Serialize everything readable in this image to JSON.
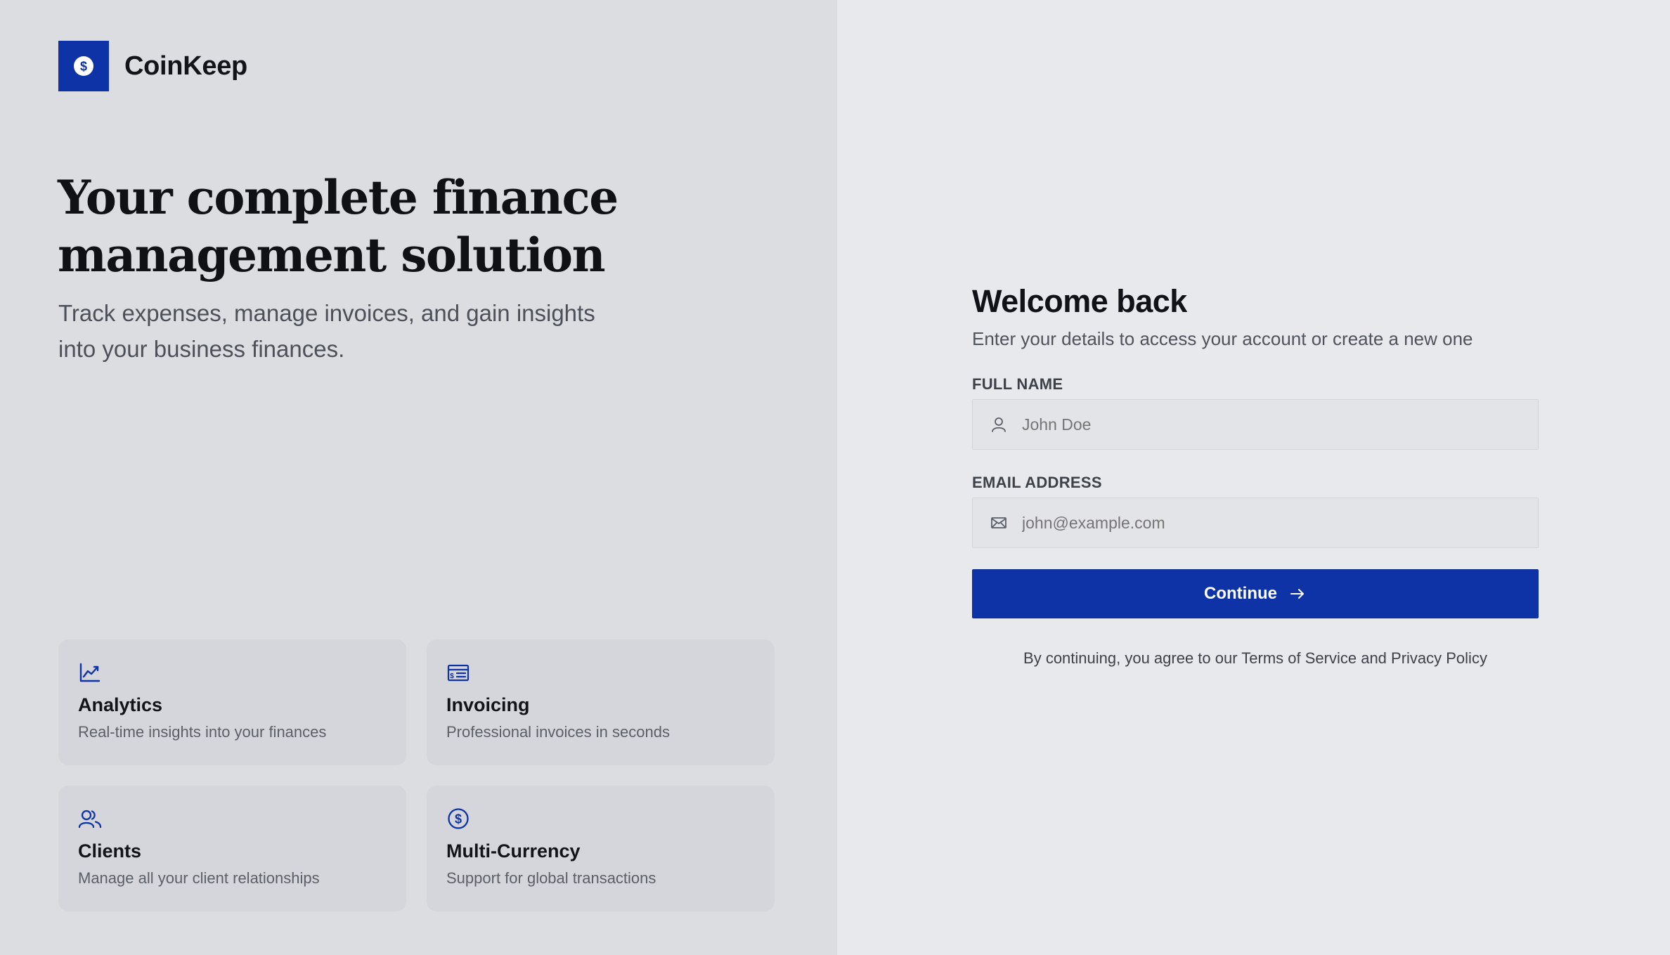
{
  "brand": {
    "name": "CoinKeep",
    "logo_icon": "dollar-circle-icon",
    "color": "#0e33a6"
  },
  "hero": {
    "title": "Your complete finance management solution",
    "subtitle": "Track expenses, manage invoices, and gain insights into your business finances."
  },
  "features": [
    {
      "icon": "chart-line-icon",
      "title": "Analytics",
      "desc": "Real-time insights into your finances"
    },
    {
      "icon": "invoice-icon",
      "title": "Invoicing",
      "desc": "Professional invoices in seconds"
    },
    {
      "icon": "users-icon",
      "title": "Clients",
      "desc": "Manage all your client relationships"
    },
    {
      "icon": "currency-icon",
      "title": "Multi-Currency",
      "desc": "Support for global transactions"
    }
  ],
  "form": {
    "title": "Welcome back",
    "subtitle": "Enter your details to access your account or create a new one",
    "name_label": "FULL NAME",
    "name_placeholder": "John Doe",
    "name_value": "",
    "email_label": "EMAIL ADDRESS",
    "email_placeholder": "john@example.com",
    "email_value": "",
    "continue_label": "Continue",
    "legal": "By continuing, you agree to our Terms of Service and Privacy Policy"
  },
  "colors": {
    "accent": "#0e33a6",
    "left_bg": "#dcdde1",
    "right_bg": "#e8e9ed"
  }
}
